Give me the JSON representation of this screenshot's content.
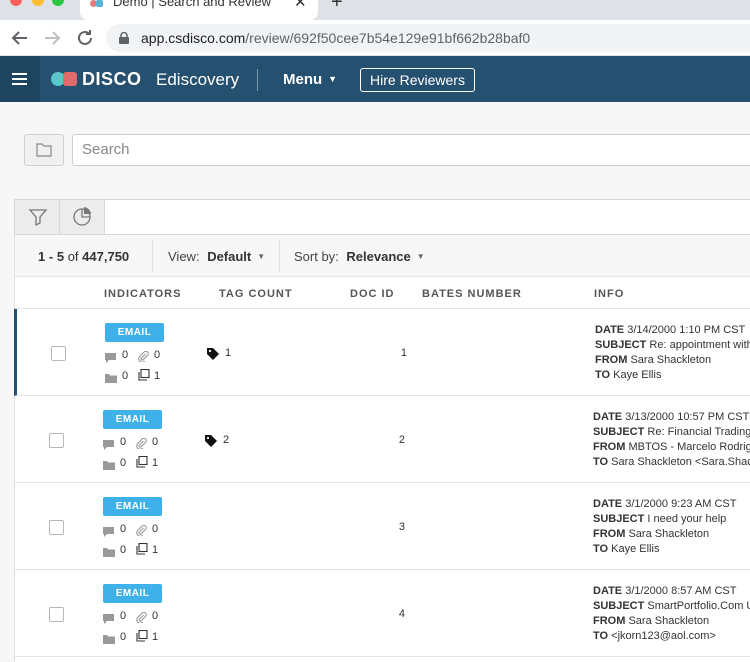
{
  "browser": {
    "tab_title": "Demo | Search and Review",
    "url_host": "app.csdisco.com",
    "url_path": "/review/692f50cee7b54e129e91bf662b28baf0"
  },
  "app": {
    "logo_text": "DISCO",
    "logo_sub": "Ediscovery",
    "menu_label": "Menu",
    "hire_label": "Hire Reviewers"
  },
  "search": {
    "placeholder": "Search"
  },
  "summary": {
    "range_start": "1",
    "range_sep": "-",
    "range_end": "5",
    "of_label": "of",
    "total": "447,750",
    "view_label": "View:",
    "view_value": "Default",
    "sort_label": "Sort by:",
    "sort_value": "Relevance"
  },
  "columns": {
    "indicators": "INDICATORS",
    "tag_count": "TAG COUNT",
    "doc_id": "DOC ID",
    "bates": "BATES NUMBER",
    "info": "INFO"
  },
  "labels": {
    "date": "DATE",
    "subject": "SUBJECT",
    "from": "FROM",
    "to": "TO"
  },
  "rows": [
    {
      "badge": "EMAIL",
      "comments": "0",
      "attachments": "0",
      "folders": "0",
      "copies": "1",
      "tag_count": "1",
      "doc_id": "1",
      "date": "3/14/2000 1:10 PM CST",
      "subject": "Re: appointment with",
      "from": "Sara Shackleton",
      "to": "Kaye Ellis"
    },
    {
      "badge": "EMAIL",
      "comments": "0",
      "attachments": "0",
      "folders": "0",
      "copies": "1",
      "tag_count": "2",
      "doc_id": "2",
      "date": "3/13/2000 10:57 PM CST",
      "subject": "Re: Financial Trading",
      "from": "MBTOS - Marcelo Rodrig",
      "to": "Sara Shackleton <Sara.Shac"
    },
    {
      "badge": "EMAIL",
      "comments": "0",
      "attachments": "0",
      "folders": "0",
      "copies": "1",
      "tag_count": "",
      "doc_id": "3",
      "date": "3/1/2000 9:23 AM CST",
      "subject": "I need your help",
      "from": "Sara Shackleton",
      "to": "Kaye Ellis"
    },
    {
      "badge": "EMAIL",
      "comments": "0",
      "attachments": "0",
      "folders": "0",
      "copies": "1",
      "tag_count": "",
      "doc_id": "4",
      "date": "3/1/2000 8:57 AM CST",
      "subject": "SmartPortfolio.Com U",
      "from": "Sara Shackleton",
      "to": "<jkorn123@aol.com>"
    }
  ]
}
